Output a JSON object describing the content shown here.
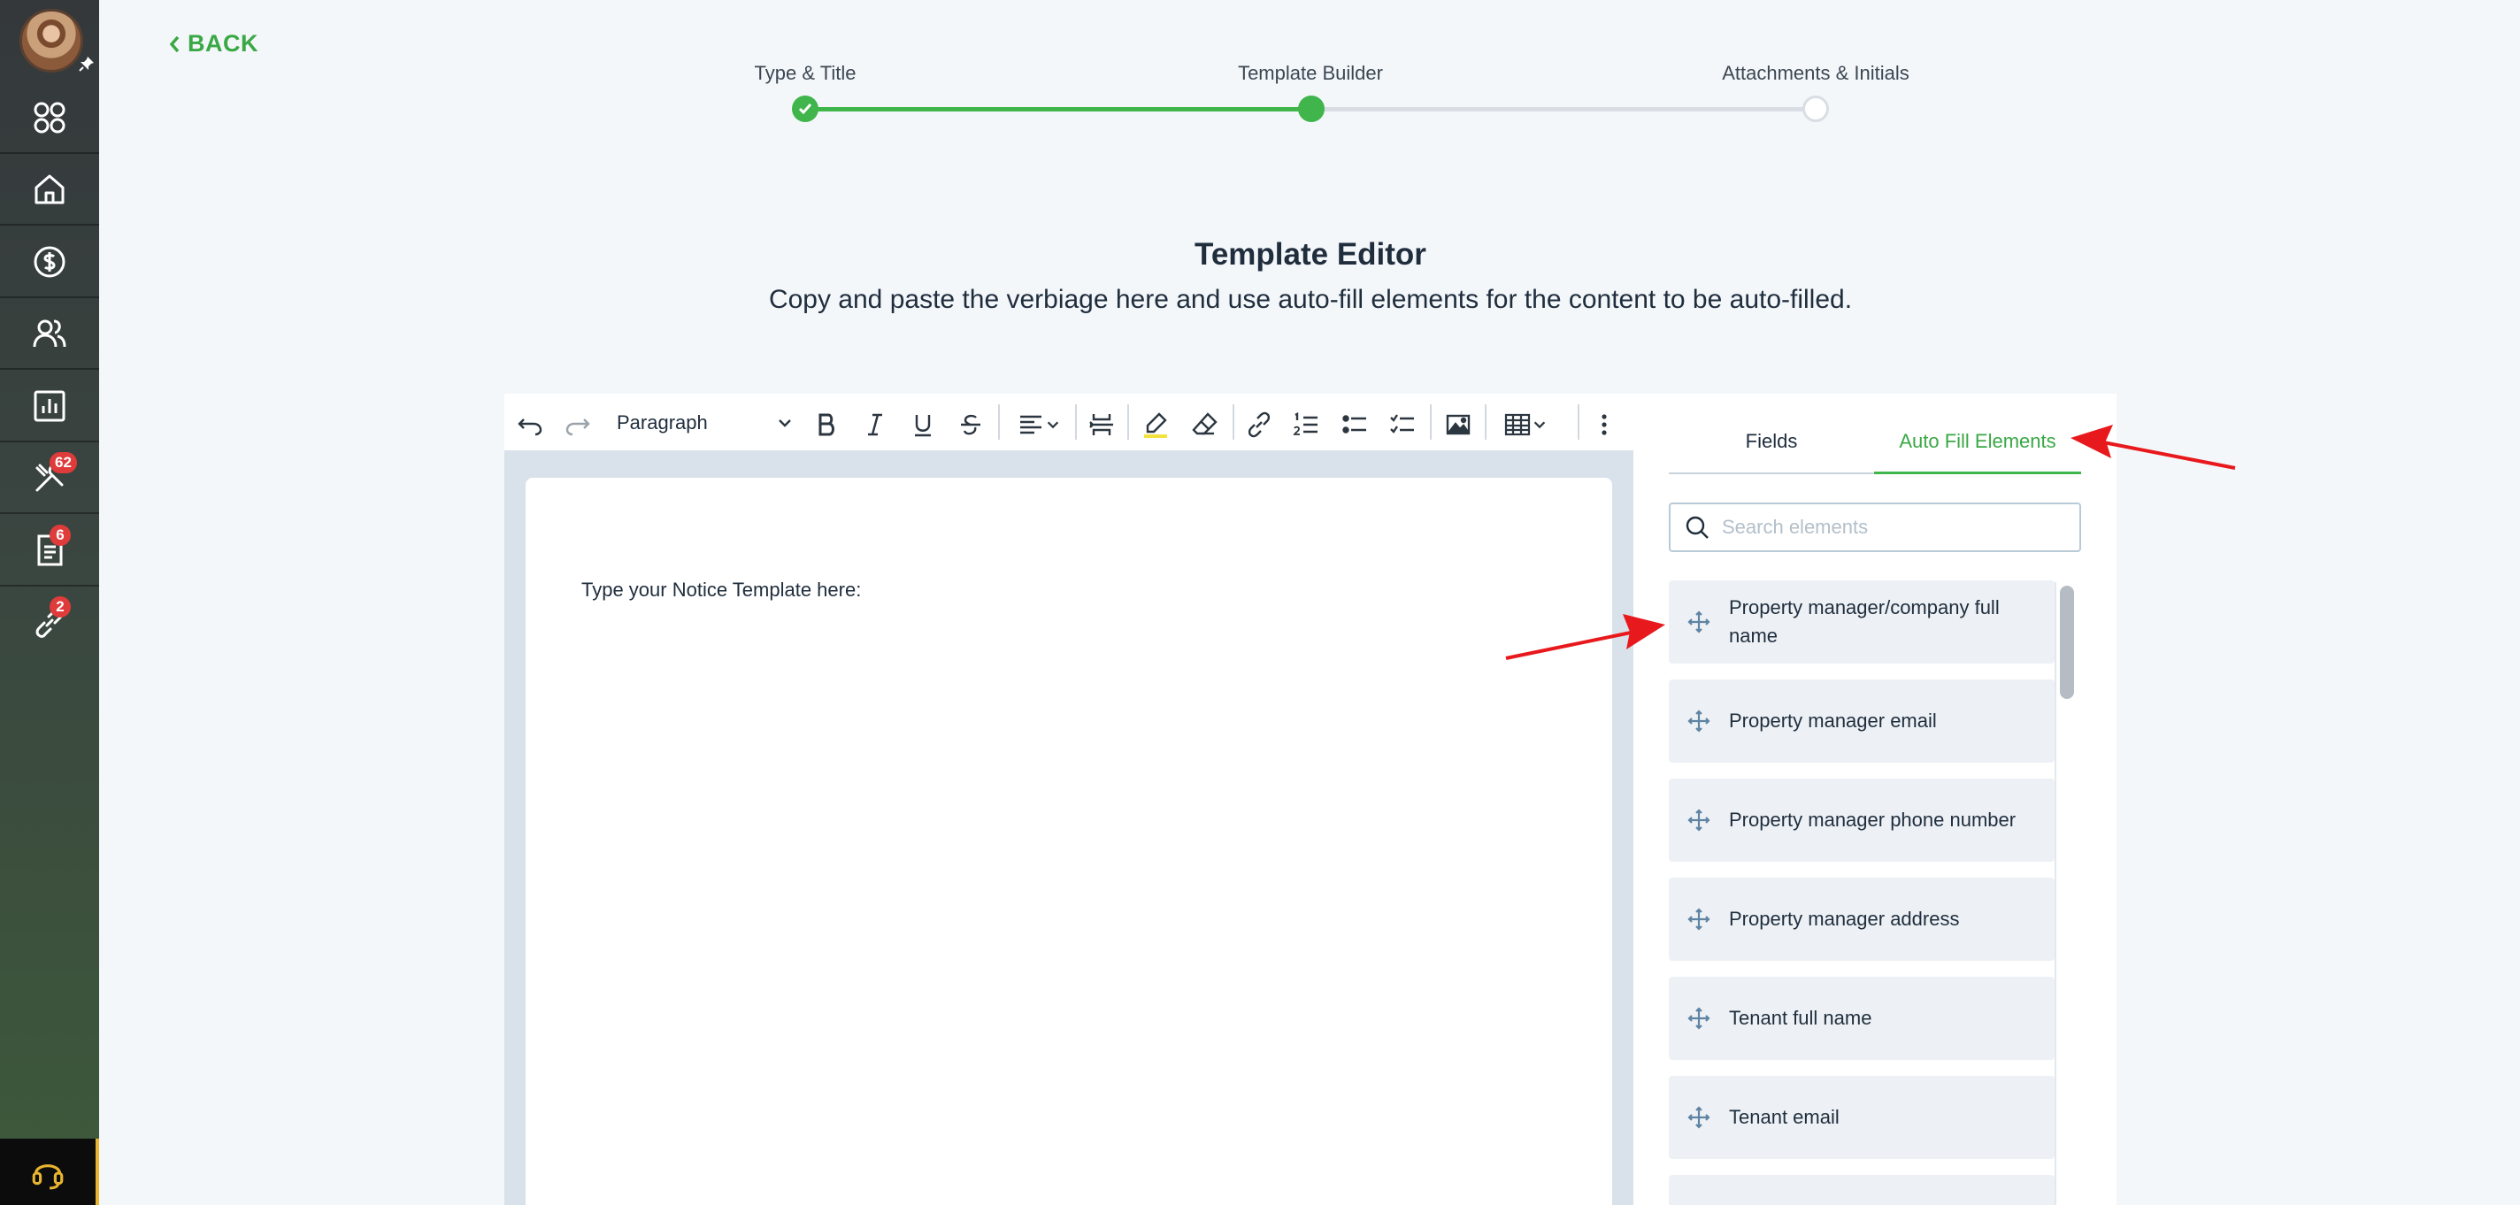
{
  "sidebar": {
    "items": [
      {
        "icon": "grid-icon",
        "badge": ""
      },
      {
        "icon": "home-icon",
        "badge": ""
      },
      {
        "icon": "dollar-icon",
        "badge": ""
      },
      {
        "icon": "users-icon",
        "badge": ""
      },
      {
        "icon": "chart-icon",
        "badge": ""
      },
      {
        "icon": "tools-icon",
        "badge": "62"
      },
      {
        "icon": "document-icon",
        "badge": "6"
      },
      {
        "icon": "link-icon",
        "badge": "2"
      }
    ],
    "support_icon": "headset-icon"
  },
  "header": {
    "back_label": "BACK"
  },
  "stepper": {
    "steps": [
      "Type & Title",
      "Template Builder",
      "Attachments & Initials"
    ]
  },
  "main": {
    "title": "Template Editor",
    "subtitle": "Copy and paste the verbiage here and use auto-fill elements for the content to be auto-filled."
  },
  "editor": {
    "block_style": "Paragraph",
    "body_text": "Type your Notice Template here:"
  },
  "right_panel": {
    "tabs": [
      "Fields",
      "Auto Fill Elements"
    ],
    "active_tab": "Auto Fill Elements",
    "search_placeholder": "Search elements",
    "elements": [
      "Property manager/company full name",
      "Property manager email",
      "Property manager phone number",
      "Property manager address",
      "Tenant full name",
      "Tenant email"
    ]
  },
  "colors": {
    "accent": "#3fb54b",
    "badge": "#e03b3b",
    "annotation_arrow": "#e8191c"
  }
}
